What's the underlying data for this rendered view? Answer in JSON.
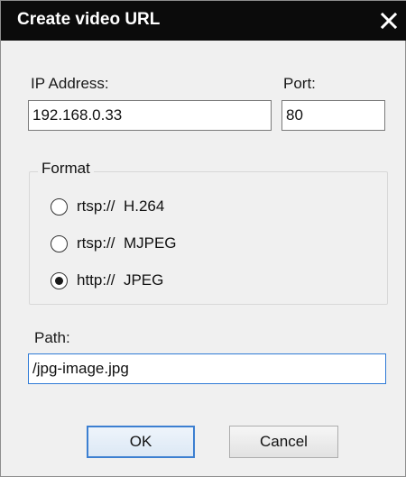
{
  "dialog": {
    "title": "Create video URL"
  },
  "ip": {
    "label": "IP Address:",
    "value": "192.168.0.33"
  },
  "port": {
    "label": "Port:",
    "value": "80"
  },
  "format": {
    "legend": "Format",
    "options": [
      {
        "label": "rtsp://  H.264",
        "selected": false
      },
      {
        "label": "rtsp://  MJPEG",
        "selected": false
      },
      {
        "label": "http://  JPEG",
        "selected": true
      }
    ]
  },
  "path": {
    "label": "Path:",
    "value": "/jpg-image.jpg"
  },
  "buttons": {
    "ok": "OK",
    "cancel": "Cancel"
  }
}
